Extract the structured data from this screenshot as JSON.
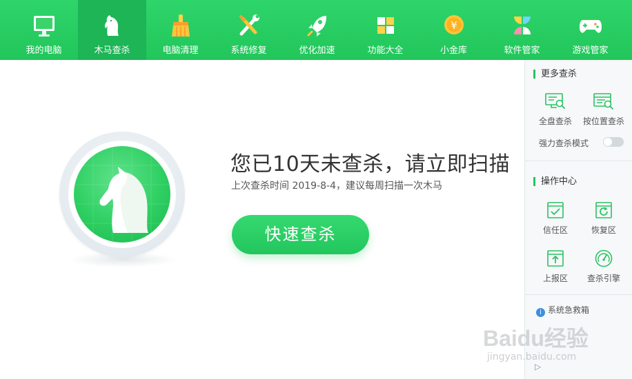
{
  "nav": {
    "items": [
      {
        "label": "我的电脑",
        "icon": "monitor-icon"
      },
      {
        "label": "木马查杀",
        "icon": "horse-icon"
      },
      {
        "label": "电脑清理",
        "icon": "broom-icon"
      },
      {
        "label": "系统修复",
        "icon": "wrench-screwdriver-icon"
      },
      {
        "label": "优化加速",
        "icon": "rocket-icon"
      },
      {
        "label": "功能大全",
        "icon": "grid-icon"
      },
      {
        "label": "小金库",
        "icon": "yen-coin-icon"
      },
      {
        "label": "软件管家",
        "icon": "software-petals-icon"
      },
      {
        "label": "游戏管家",
        "icon": "gamepad-icon"
      }
    ],
    "active_index": 1
  },
  "main": {
    "headline": "您已10天未查杀，请立即扫描",
    "subline": "上次查杀时间 2019-8-4，建议每周扫描一次木马",
    "scan_button": "快速查杀"
  },
  "sidebar": {
    "more_scan": {
      "title": "更多查杀",
      "buttons": [
        {
          "label": "全盘查杀",
          "icon": "full-disk-scan-icon"
        },
        {
          "label": "按位置查杀",
          "icon": "location-scan-icon"
        }
      ],
      "toggle_label": "强力查杀模式",
      "toggle_on": false
    },
    "ops": {
      "title": "操作中心",
      "buttons": [
        {
          "label": "信任区",
          "icon": "trust-zone-icon"
        },
        {
          "label": "恢复区",
          "icon": "restore-zone-icon"
        },
        {
          "label": "上报区",
          "icon": "upload-zone-icon"
        },
        {
          "label": "查杀引擎",
          "icon": "engine-gauge-icon"
        }
      ]
    },
    "rescue": "系统急救箱",
    "expand_arrow": "▷"
  },
  "watermark": {
    "brand": "Baidu经验",
    "url": "jingyan.baidu.com"
  },
  "colors": {
    "brand_green": "#22c65c",
    "active_tab": "#1db556",
    "info_blue": "#3d8fe0"
  }
}
